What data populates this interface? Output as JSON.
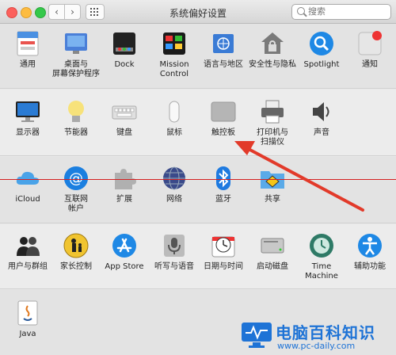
{
  "window": {
    "title": "系统偏好设置",
    "search_placeholder": "搜索"
  },
  "nav": {
    "back": "‹",
    "forward": "›"
  },
  "sections": [
    {
      "items": [
        {
          "name": "general",
          "label": "通用",
          "icon": "general-icon",
          "color": "#4a90e2"
        },
        {
          "name": "desktop",
          "label": "桌面与\n屏幕保护程序",
          "icon": "desktop-icon",
          "color": "#3d6fd6"
        },
        {
          "name": "dock",
          "label": "Dock",
          "icon": "dock-icon",
          "color": "#333"
        },
        {
          "name": "mission-control",
          "label": "Mission\nControl",
          "icon": "mission-control-icon",
          "color": "#222"
        },
        {
          "name": "language",
          "label": "语言与地区",
          "icon": "flag-icon",
          "color": "#3a7bd5"
        },
        {
          "name": "security",
          "label": "安全性与隐私",
          "icon": "house-lock-icon",
          "color": "#666"
        },
        {
          "name": "spotlight",
          "label": "Spotlight",
          "icon": "magnifier-icon",
          "color": "#1e88e5"
        },
        {
          "name": "notifications",
          "label": "通知",
          "icon": "notification-icon",
          "color": "#ddd"
        }
      ]
    },
    {
      "items": [
        {
          "name": "displays",
          "label": "显示器",
          "icon": "display-icon",
          "color": "#2a7bd4"
        },
        {
          "name": "energy",
          "label": "节能器",
          "icon": "bulb-icon",
          "color": "#f2d34a"
        },
        {
          "name": "keyboard",
          "label": "键盘",
          "icon": "keyboard-icon",
          "color": "#bbb"
        },
        {
          "name": "mouse",
          "label": "鼠标",
          "icon": "mouse-icon",
          "color": "#eee"
        },
        {
          "name": "trackpad",
          "label": "触控板",
          "icon": "trackpad-icon",
          "color": "#b5b5b5"
        },
        {
          "name": "printers",
          "label": "打印机与\n扫描仪",
          "icon": "printer-icon",
          "color": "#666"
        },
        {
          "name": "sound",
          "label": "声音",
          "icon": "speaker-icon",
          "color": "#444"
        }
      ]
    },
    {
      "items": [
        {
          "name": "icloud",
          "label": "iCloud",
          "icon": "cloud-icon",
          "color": "#4aa3e8"
        },
        {
          "name": "internet-accounts",
          "label": "互联网\n帐户",
          "icon": "at-icon",
          "color": "#1b7fe0"
        },
        {
          "name": "extensions",
          "label": "扩展",
          "icon": "puzzle-icon",
          "color": "#aaa"
        },
        {
          "name": "network",
          "label": "网络",
          "icon": "globe-icon",
          "color": "#5a6fa8"
        },
        {
          "name": "bluetooth",
          "label": "蓝牙",
          "icon": "bluetooth-icon",
          "color": "#1e7ae0"
        },
        {
          "name": "sharing",
          "label": "共享",
          "icon": "sharing-folder-icon",
          "color": "#5aaae8"
        }
      ]
    },
    {
      "items": [
        {
          "name": "users",
          "label": "用户与群组",
          "icon": "users-icon",
          "color": "#222"
        },
        {
          "name": "parental",
          "label": "家长控制",
          "icon": "parental-icon",
          "color": "#f0c430"
        },
        {
          "name": "appstore",
          "label": "App Store",
          "icon": "appstore-icon",
          "color": "#1e88e5"
        },
        {
          "name": "dictation",
          "label": "听写与语音",
          "icon": "microphone-icon",
          "color": "#888"
        },
        {
          "name": "datetime",
          "label": "日期与时间",
          "icon": "clock-icon",
          "color": "#ddd"
        },
        {
          "name": "startup",
          "label": "启动磁盘",
          "icon": "disk-icon",
          "color": "#999"
        },
        {
          "name": "timemachine",
          "label": "Time Machine",
          "icon": "timemachine-icon",
          "color": "#2e8b6b"
        },
        {
          "name": "accessibility",
          "label": "辅助功能",
          "icon": "accessibility-icon",
          "color": "#1e88e5"
        }
      ]
    },
    {
      "items": [
        {
          "name": "java",
          "label": "Java",
          "icon": "java-icon",
          "color": "#e07a20"
        }
      ]
    }
  ],
  "watermark": {
    "title": "电脑百科知识",
    "url": "www.pc-daily.com",
    "color": "#1e73d6"
  }
}
